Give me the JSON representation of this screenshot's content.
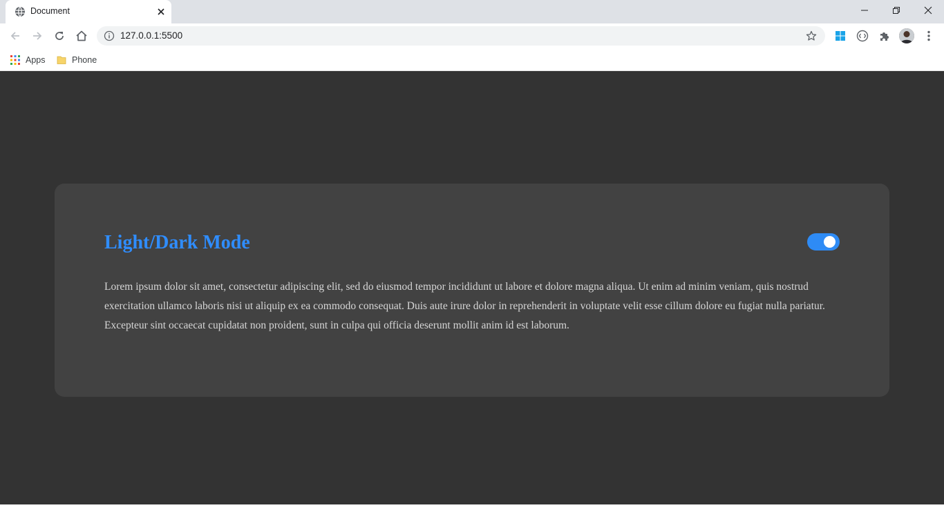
{
  "browser": {
    "tab": {
      "title": "Document"
    },
    "address_bar": {
      "url": "127.0.0.1:5500"
    },
    "bookmarks": [
      {
        "label": "Apps"
      },
      {
        "label": "Phone"
      }
    ]
  },
  "page": {
    "title": "Light/Dark Mode",
    "toggle": {
      "state": "on",
      "color": "#2e8bf5"
    },
    "body_text": "Lorem ipsum dolor sit amet, consectetur adipiscing elit, sed do eiusmod tempor incididunt ut labore et dolore magna aliqua. Ut enim ad minim veniam, quis nostrud exercitation ullamco laboris nisi ut aliquip ex ea commodo consequat. Duis aute irure dolor in reprehenderit in voluptate velit esse cillum dolore eu fugiat nulla pariatur. Excepteur sint occaecat cupidatat non proident, sunt in culpa qui officia deserunt mollit anim id est laborum."
  },
  "colors": {
    "page_background": "#333333",
    "card_background": "#424242",
    "accent": "#2f8dff"
  }
}
